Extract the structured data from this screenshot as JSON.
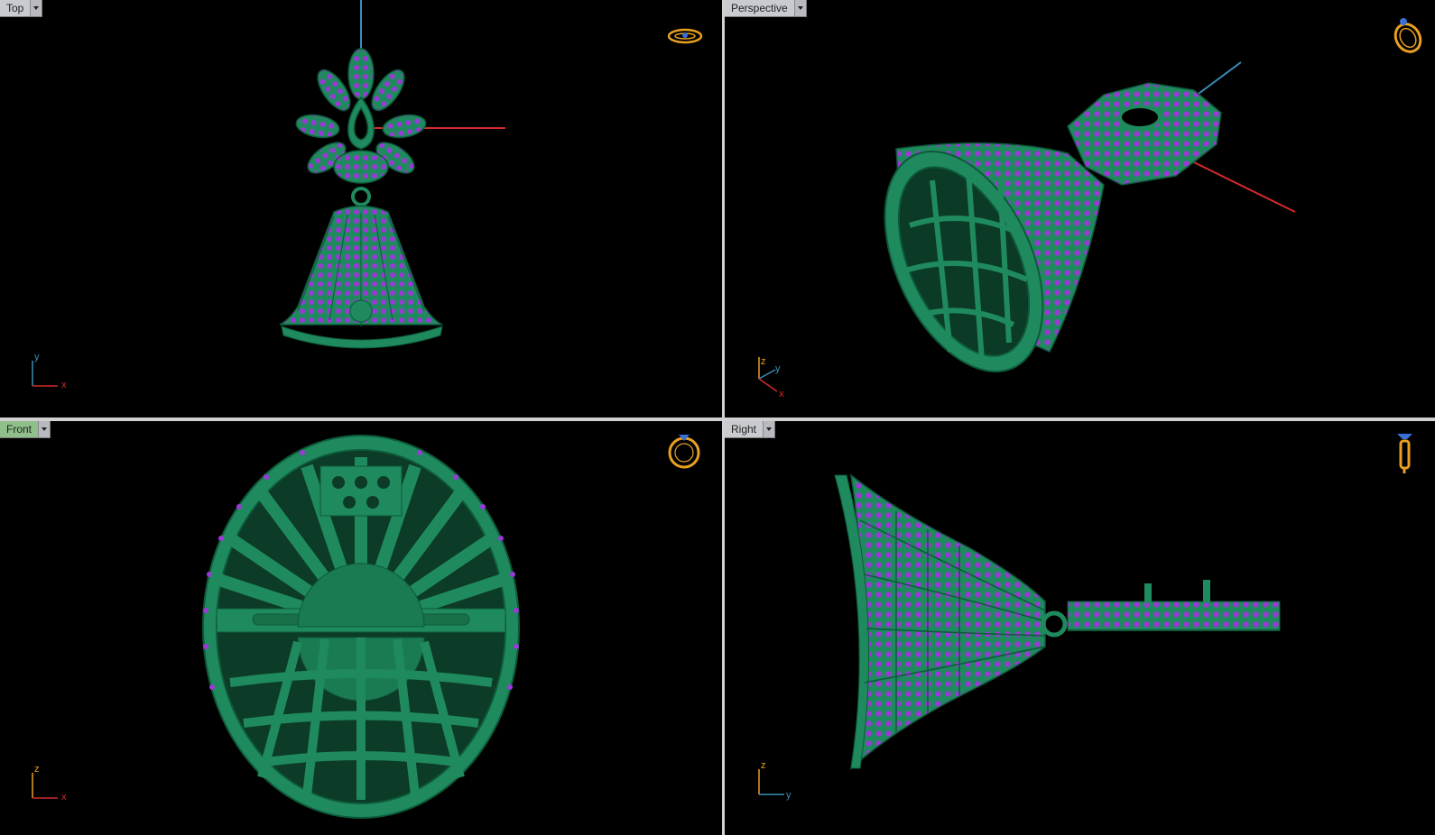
{
  "viewports": {
    "top": {
      "label": "Top",
      "axis_h": "x",
      "axis_v": "y",
      "active": false
    },
    "persp": {
      "label": "Perspective",
      "axis_h": "x",
      "axis_v": "z",
      "axis_d": "y",
      "active": false
    },
    "front": {
      "label": "Front",
      "axis_h": "x",
      "axis_v": "z",
      "active": true
    },
    "right": {
      "label": "Right",
      "axis_h": "y",
      "axis_v": "z",
      "active": false
    }
  },
  "colors": {
    "background": "#000000",
    "model_green": "#1f8a5e",
    "model_edge": "#0d5a3a",
    "gem_purple": "#9a3ad6",
    "axis_red": "#d22b2b",
    "axis_blue": "#3a8fb8",
    "axis_green": "#2ea24a",
    "icon_gold": "#e8a020",
    "active_label": "#8fbf8a",
    "inactive_label": "#c9cbd0"
  },
  "icons": {
    "top": "ring-top-view-icon",
    "persp": "ring-perspective-icon",
    "front": "ring-front-view-icon",
    "right": "ring-side-view-icon"
  }
}
